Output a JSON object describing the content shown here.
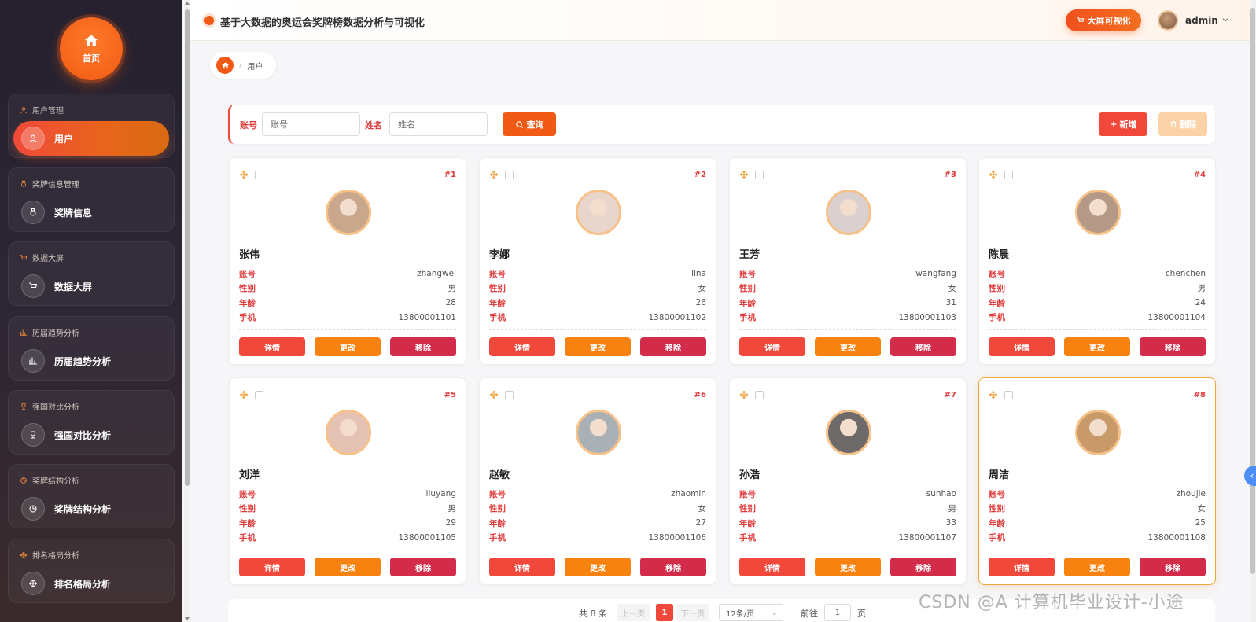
{
  "app": {
    "title": "基于大数据的奥运会奖牌榜数据分析与可视化",
    "big_screen_label": "大屏可视化",
    "user_name": "admin"
  },
  "sidebar": {
    "home_label": "首页",
    "groups": [
      {
        "title": "用户管理",
        "item": "用户",
        "icon": "user-icon",
        "active": true
      },
      {
        "title": "奖牌信息管理",
        "item": "奖牌信息",
        "icon": "medal-icon",
        "active": false
      },
      {
        "title": "数据大屏",
        "item": "数据大屏",
        "icon": "cart-icon",
        "active": false
      },
      {
        "title": "历届趋势分析",
        "item": "历届趋势分析",
        "icon": "trend-icon",
        "active": false
      },
      {
        "title": "强国对比分析",
        "item": "强国对比分析",
        "icon": "trophy-icon",
        "active": false
      },
      {
        "title": "奖牌结构分析",
        "item": "奖牌结构分析",
        "icon": "pie-icon",
        "active": false
      },
      {
        "title": "排名格局分析",
        "item": "排名格局分析",
        "icon": "move-icon",
        "active": false
      }
    ]
  },
  "breadcrumb": {
    "current": "用户",
    "separator": "/"
  },
  "search": {
    "account_label": "账号",
    "account_placeholder": "账号",
    "name_label": "姓名",
    "name_placeholder": "姓名",
    "query_label": "查询",
    "add_label": "新增",
    "delete_label": "删除"
  },
  "card_labels": {
    "account": "账号",
    "gender": "性别",
    "age": "年龄",
    "phone": "手机",
    "detail": "详情",
    "edit": "更改",
    "remove": "移除"
  },
  "users": [
    {
      "index": "#1",
      "name": "张伟",
      "account": "zhangwei",
      "gender": "男",
      "age": "28",
      "phone": "13800001101",
      "avatar_color": "#c9a78c"
    },
    {
      "index": "#2",
      "name": "李娜",
      "account": "lina",
      "gender": "女",
      "age": "26",
      "phone": "13800001102",
      "avatar_color": "#e8d6cc"
    },
    {
      "index": "#3",
      "name": "王芳",
      "account": "wangfang",
      "gender": "女",
      "age": "31",
      "phone": "13800001103",
      "avatar_color": "#d9d0cf"
    },
    {
      "index": "#4",
      "name": "陈晨",
      "account": "chenchen",
      "gender": "男",
      "age": "24",
      "phone": "13800001104",
      "avatar_color": "#b49a86"
    },
    {
      "index": "#5",
      "name": "刘洋",
      "account": "liuyang",
      "gender": "男",
      "age": "29",
      "phone": "13800001105",
      "avatar_color": "#e4c2b4"
    },
    {
      "index": "#6",
      "name": "赵敏",
      "account": "zhaomin",
      "gender": "女",
      "age": "27",
      "phone": "13800001106",
      "avatar_color": "#a9b0b6"
    },
    {
      "index": "#7",
      "name": "孙浩",
      "account": "sunhao",
      "gender": "男",
      "age": "33",
      "phone": "13800001107",
      "avatar_color": "#6e6a6a"
    },
    {
      "index": "#8",
      "name": "周洁",
      "account": "zhoujie",
      "gender": "女",
      "age": "25",
      "phone": "13800001108",
      "avatar_color": "#c89a6a"
    }
  ],
  "pagination": {
    "total": "共 8 条",
    "prev": "上一页",
    "page": "1",
    "next": "下一页",
    "page_size": "12条/页",
    "goto": "前往",
    "goto_value": "1",
    "page_unit": "页"
  },
  "watermark": "CSDN @A 计算机毕业设计-小途",
  "colors": {
    "accent": "#f05a14",
    "danger": "#f0483a",
    "warning": "#f8820f",
    "remove": "#d22c4a"
  }
}
